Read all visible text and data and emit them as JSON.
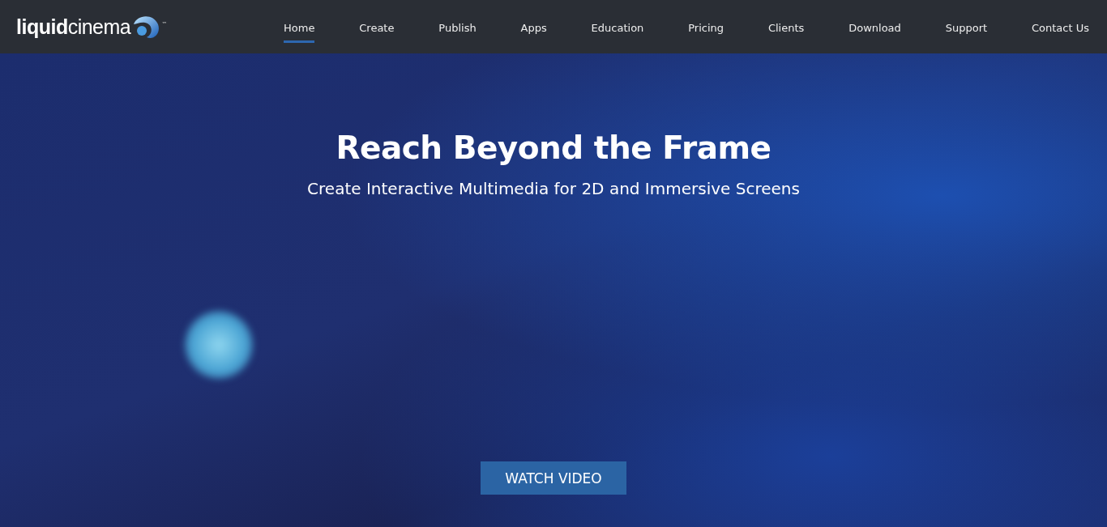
{
  "header": {
    "logo": "**liquid**cinema",
    "logo_mark": "™",
    "nav": [
      {
        "label": "Home",
        "selected": true
      },
      {
        "label": "Create",
        "selected": false
      },
      {
        "label": "Publish",
        "selected": false
      },
      {
        "label": "Apps",
        "selected": false
      },
      {
        "label": "Education",
        "selected": false
      },
      {
        "label": "Pricing",
        "selected": false
      },
      {
        "label": "Clients",
        "selected": false
      },
      {
        "label": "Download",
        "selected": false
      },
      {
        "label": "Support",
        "selected": false
      },
      {
        "label": "Contact Us",
        "selected": false
      }
    ]
  },
  "hero": {
    "title": "Reach Beyond the Frame",
    "subtitle": "Create Interactive Multimedia for 2D and Immersive Screens",
    "button": "WATCH VIDEO"
  }
}
